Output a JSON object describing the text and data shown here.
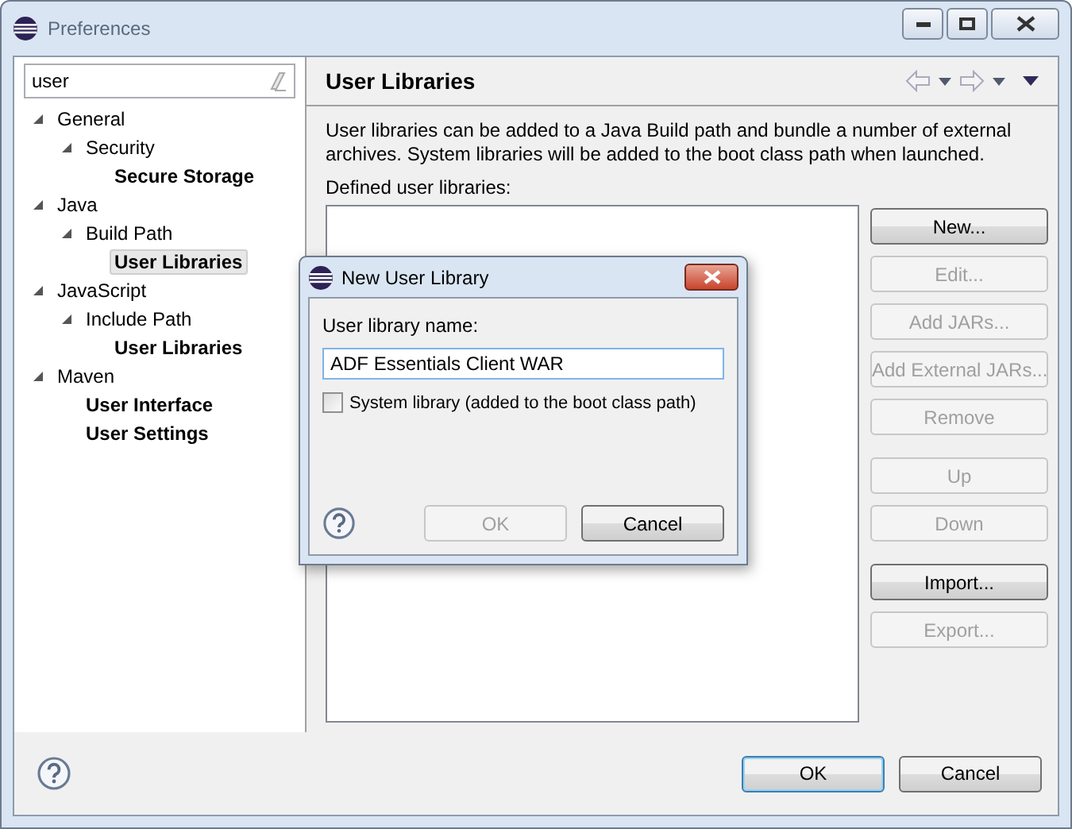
{
  "window": {
    "title": "Preferences"
  },
  "filter": {
    "value": "user"
  },
  "tree": [
    {
      "label": "General",
      "match": false,
      "selected": false,
      "expanded": true,
      "children": [
        {
          "label": "Security",
          "match": false,
          "selected": false,
          "expanded": true,
          "children": [
            {
              "label": "Secure Storage",
              "match": true,
              "selected": false
            }
          ]
        }
      ]
    },
    {
      "label": "Java",
      "match": false,
      "selected": false,
      "expanded": true,
      "children": [
        {
          "label": "Build Path",
          "match": false,
          "selected": false,
          "expanded": true,
          "children": [
            {
              "label": "User Libraries",
              "match": true,
              "selected": true
            }
          ]
        }
      ]
    },
    {
      "label": "JavaScript",
      "match": false,
      "selected": false,
      "expanded": true,
      "children": [
        {
          "label": "Include Path",
          "match": false,
          "selected": false,
          "expanded": true,
          "children": [
            {
              "label": "User Libraries",
              "match": true,
              "selected": false
            }
          ]
        }
      ]
    },
    {
      "label": "Maven",
      "match": false,
      "selected": false,
      "expanded": true,
      "children": [
        {
          "label": "User Interface",
          "match": true,
          "selected": false
        },
        {
          "label": "User Settings",
          "match": true,
          "selected": false
        }
      ]
    }
  ],
  "page": {
    "title": "User Libraries",
    "description": "User libraries can be added to a Java Build path and bundle a number of external archives. System libraries will be added to the boot class path when launched.",
    "list_label": "Defined user libraries:"
  },
  "button_groups": [
    [
      {
        "label": "New...",
        "disabled": false
      },
      {
        "label": "Edit...",
        "disabled": true
      },
      {
        "label": "Add JARs...",
        "disabled": true
      },
      {
        "label": "Add External JARs...",
        "disabled": true
      },
      {
        "label": "Remove",
        "disabled": true
      }
    ],
    [
      {
        "label": "Up",
        "disabled": true
      },
      {
        "label": "Down",
        "disabled": true
      }
    ],
    [
      {
        "label": "Import...",
        "disabled": false
      },
      {
        "label": "Export...",
        "disabled": true
      }
    ]
  ],
  "footer_buttons": [
    {
      "label": "OK",
      "disabled": false,
      "default": true
    },
    {
      "label": "Cancel",
      "disabled": false,
      "default": false
    }
  ],
  "dialog": {
    "title": "New User Library",
    "name_label": "User library name:",
    "name_value": "ADF Essentials Client WAR",
    "system_library": {
      "label": "System library (added to the boot class path)",
      "checked": false
    },
    "buttons": [
      {
        "label": "OK",
        "disabled": true
      },
      {
        "label": "Cancel",
        "disabled": false
      }
    ]
  }
}
